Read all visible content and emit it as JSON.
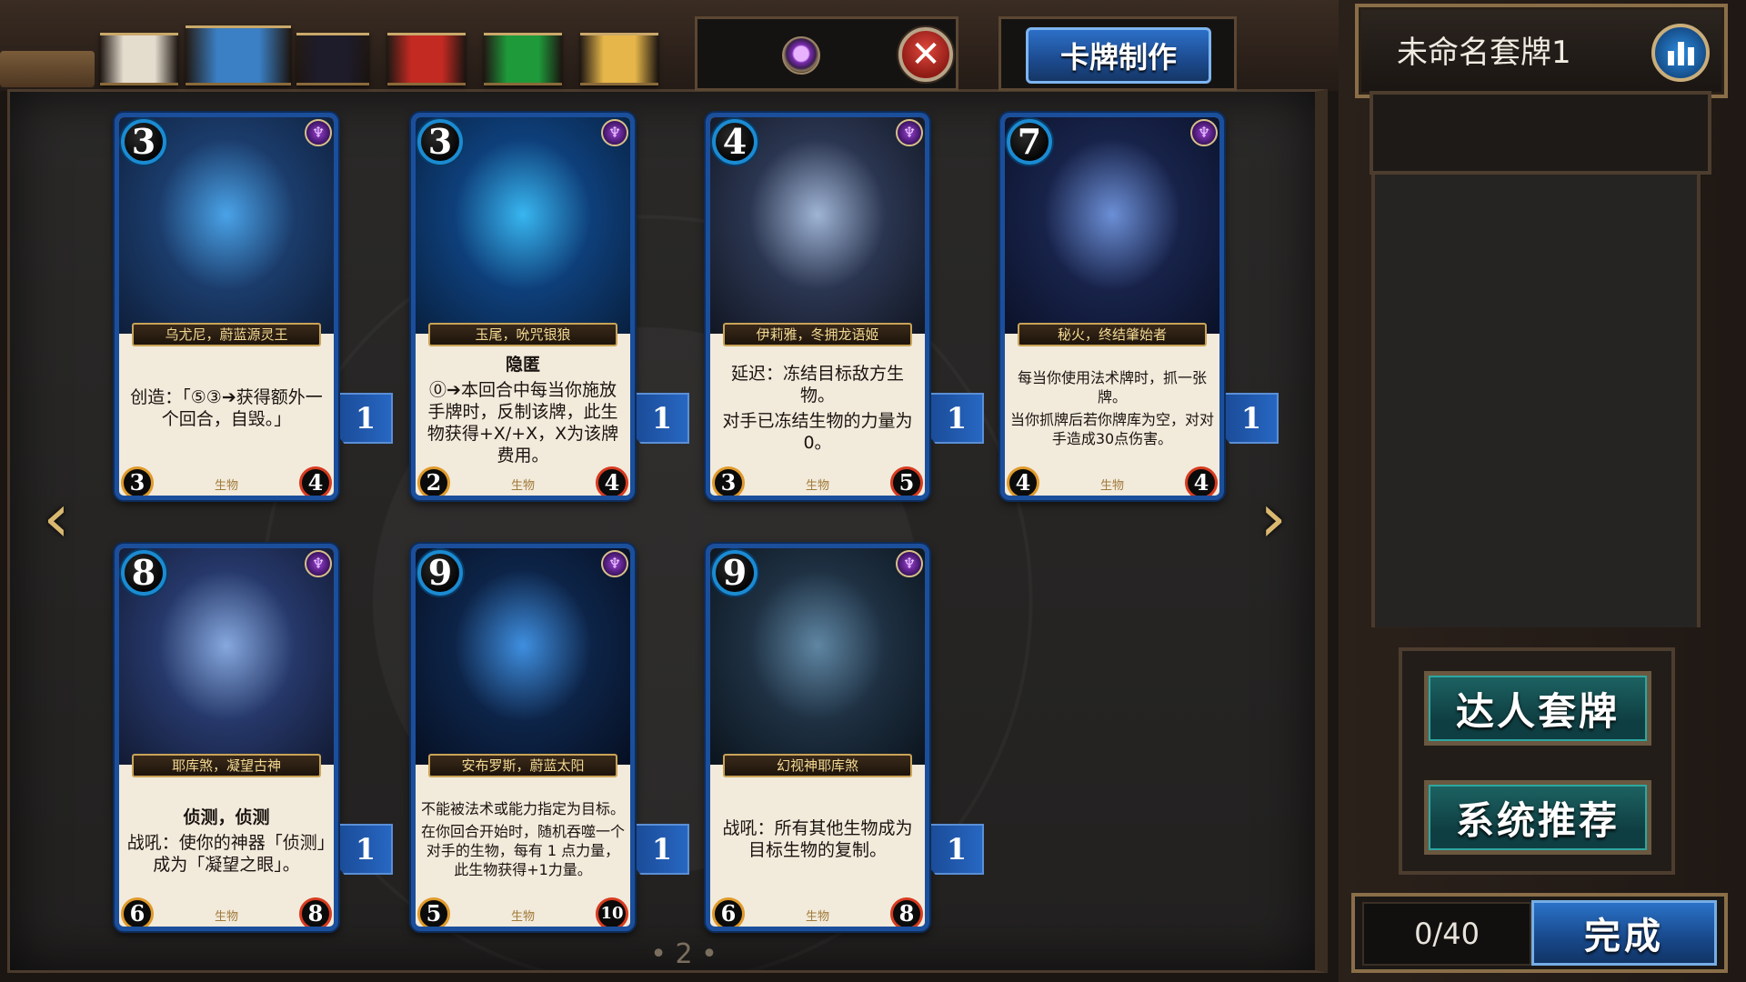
{
  "color_filters": [
    {
      "name": "white",
      "color": "#e4dccd"
    },
    {
      "name": "blue",
      "color": "#3b7fc4",
      "selected": true
    },
    {
      "name": "black",
      "color": "#1e1b2a"
    },
    {
      "name": "red",
      "color": "#c32a22"
    },
    {
      "name": "green",
      "color": "#1f9a3a"
    },
    {
      "name": "gold",
      "color": "#e6b64a"
    }
  ],
  "toolbar": {
    "gem_filter_icon": "purple-gem-icon",
    "clear_icon": "close-icon",
    "clear_glyph": "✕",
    "craft_label": "卡牌制作"
  },
  "deck": {
    "name": "未命名套牌1",
    "stats_icon": "bar-chart-icon",
    "count": "0/40",
    "done_label": "完成",
    "expert_label": "达人套牌",
    "recommend_label": "系统推荐"
  },
  "nav": {
    "prev_glyph": "‹",
    "next_glyph": "›",
    "page": "• 2 •"
  },
  "cards": [
    {
      "cost": "3",
      "name": "乌尤尼，蔚蓝源灵王",
      "lines": [
        "创造：「⑤③➔获得额外一个回合，自毁。」"
      ],
      "type": "生物",
      "attack": "3",
      "health": "4",
      "count": "1",
      "art": [
        "#1b3c6b",
        "#4aa3e8",
        "#0e1e3a"
      ]
    },
    {
      "cost": "3",
      "name": "玉尾，吮咒银狼",
      "keyword": "隐匿",
      "lines": [
        "⓪➔本回合中每当你施放手牌时，反制该牌，此生物获得+X/+X，X为该牌费用。"
      ],
      "type": "生物",
      "attack": "2",
      "health": "4",
      "count": "1",
      "art": [
        "#0e3f7a",
        "#38b6f0",
        "#08203f"
      ]
    },
    {
      "cost": "4",
      "name": "伊莉雅，冬拥龙语姬",
      "lines": [
        "延迟：冻结目标敌方生物。",
        "对手已冻结生物的力量为0。"
      ],
      "type": "生物",
      "attack": "3",
      "health": "5",
      "count": "1",
      "art": [
        "#2a3550",
        "#9fb4d4",
        "#111622"
      ]
    },
    {
      "cost": "7",
      "name": "秘火，终结肇始者",
      "lines": [
        "每当你使用法术牌时，抓一张牌。",
        "当你抓牌后若你牌库为空，对对手造成30点伤害。"
      ],
      "small": true,
      "type": "生物",
      "attack": "4",
      "health": "4",
      "count": "1",
      "art": [
        "#18234a",
        "#6c8fd6",
        "#0a1128"
      ]
    },
    {
      "cost": "8",
      "name": "耶库煞，凝望古神",
      "keyword": "侦测，侦测",
      "lines": [
        "战吼：使你的神器「侦测」成为「凝望之眼」。"
      ],
      "type": "生物",
      "attack": "6",
      "health": "8",
      "count": "1",
      "art": [
        "#26386a",
        "#86a8de",
        "#121a33"
      ]
    },
    {
      "cost": "9",
      "name": "安布罗斯，蔚蓝太阳",
      "lines": [
        "不能被法术或能力指定为目标。",
        "在你回合开始时，随机吞噬一个对手的生物，每有 1 点力量，此生物获得+1力量。"
      ],
      "small": true,
      "type": "生物",
      "attack": "5",
      "health": "10",
      "count": "1",
      "art": [
        "#0d2448",
        "#3f8fe0",
        "#060f22"
      ]
    },
    {
      "cost": "9",
      "name": "幻视神耶库煞",
      "lines": [
        "战吼：所有其他生物成为目标生物的复制。"
      ],
      "type": "生物",
      "attack": "6",
      "health": "8",
      "count": "1",
      "art": [
        "#1e3042",
        "#5f86a3",
        "#0b141d"
      ]
    }
  ]
}
